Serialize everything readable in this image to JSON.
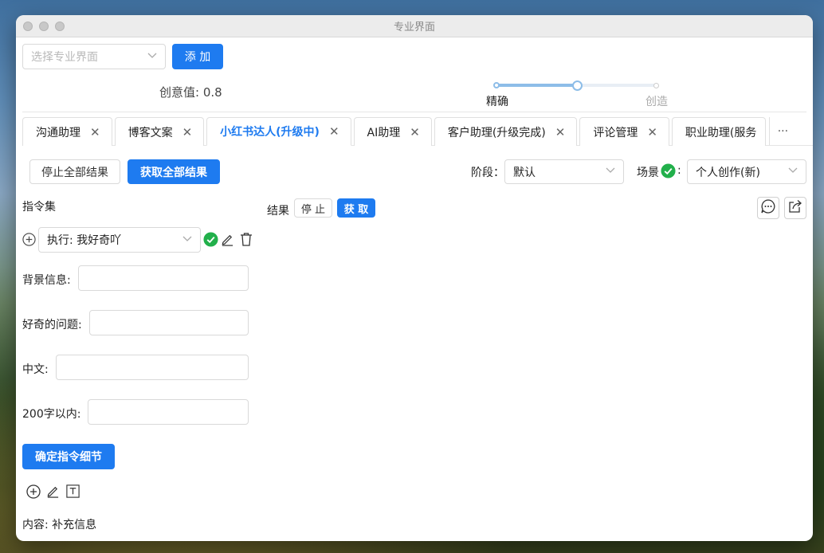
{
  "window": {
    "title": "专业界面"
  },
  "top": {
    "select_placeholder": "选择专业界面",
    "add_label": "添 加",
    "creativity_label": "创意值: 0.8",
    "creativity_value": 0.8,
    "slider_left_label": "精确",
    "slider_right_label": "创造"
  },
  "tabs": [
    {
      "label": "沟通助理",
      "active": false
    },
    {
      "label": "博客文案",
      "active": false
    },
    {
      "label": "小红书达人(升级中)",
      "active": true
    },
    {
      "label": "AI助理",
      "active": false
    },
    {
      "label": "客户助理(升级完成)",
      "active": false
    },
    {
      "label": "评论管理",
      "active": false
    },
    {
      "label": "职业助理(服务",
      "active": false
    }
  ],
  "tab_close_glyph": "✕",
  "tab_more_glyph": "···",
  "toolbar": {
    "stop_all_label": "停止全部结果",
    "get_all_label": "获取全部结果",
    "stage_label": "阶段：",
    "stage_value": "默认",
    "scene_label": "场景",
    "scene_colon": ":",
    "scene_value": "个人创作(新)"
  },
  "left": {
    "instruction_set_label": "指令集",
    "execute_value": "执行: 我好奇吖",
    "fields": [
      {
        "label": "背景信息:",
        "value": ""
      },
      {
        "label": "好奇的问题:",
        "value": ""
      },
      {
        "label": "中文:",
        "value": ""
      },
      {
        "label": "200字以内:",
        "value": ""
      }
    ],
    "confirm_label": "确定指令细节",
    "content_label": "内容: 补充信息"
  },
  "result": {
    "label": "结果",
    "stop_label": "停 止",
    "get_label": "获 取"
  },
  "colors": {
    "accent": "#1e7bf0",
    "success": "#22b04b"
  },
  "icons": [
    "plus-circle-icon",
    "check-circle-icon",
    "edit-icon",
    "trash-icon",
    "chat-icon",
    "share-icon",
    "text-box-icon",
    "chevron-down-icon",
    "close-icon"
  ]
}
